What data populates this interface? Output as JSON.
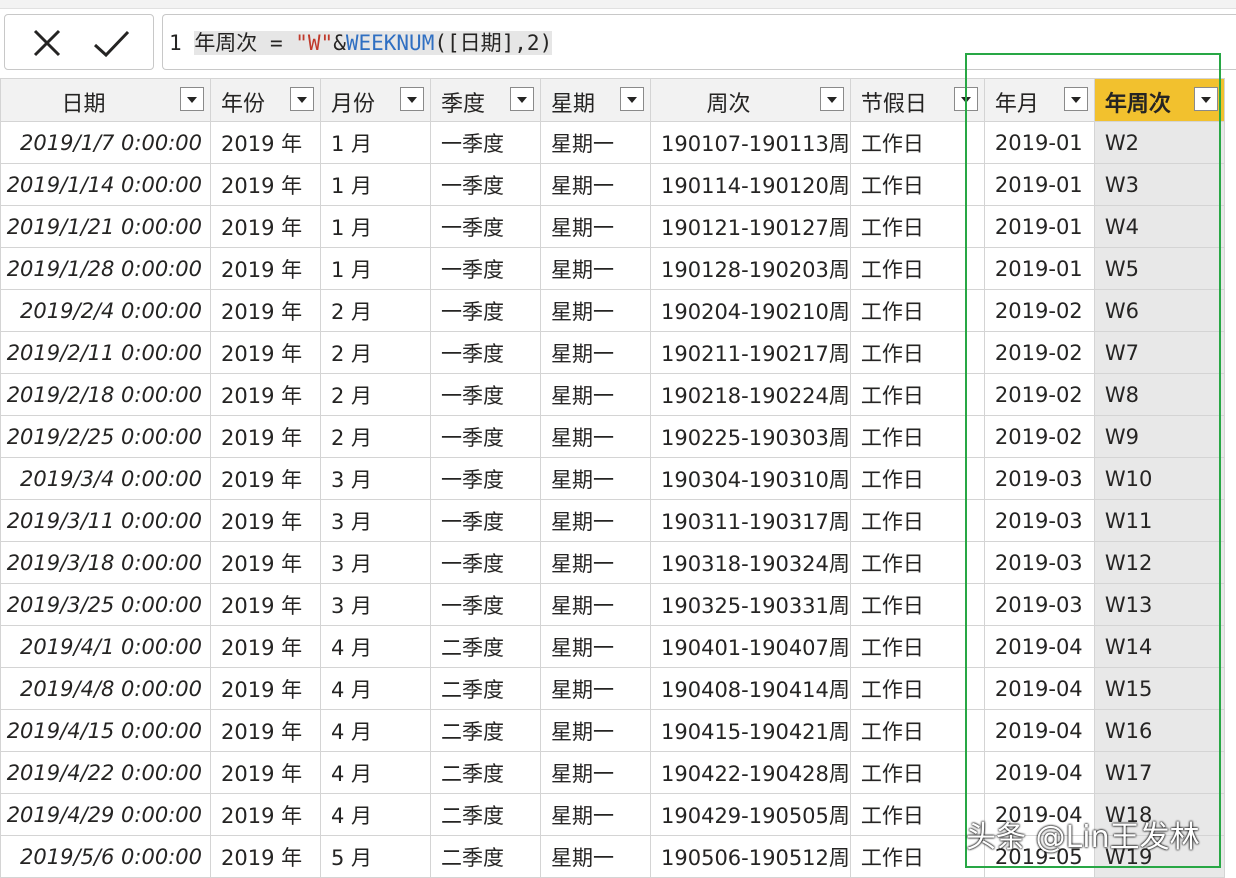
{
  "formula": {
    "line_number": "1",
    "column_name": "年周次",
    "equals": " = ",
    "string_literal": "\"W\"",
    "ampersand": "&",
    "function_name": "WEEKNUM",
    "arguments": "([日期],2)"
  },
  "columns": [
    "日期",
    "年份",
    "月份",
    "季度",
    "星期",
    "周次",
    "节假日",
    "年月",
    "年周次"
  ],
  "rows": [
    [
      "2019/1/7 0:00:00",
      "2019 年",
      "1 月",
      "一季度",
      "星期一",
      "190107-190113周",
      "工作日",
      "2019-01",
      "W2"
    ],
    [
      "2019/1/14 0:00:00",
      "2019 年",
      "1 月",
      "一季度",
      "星期一",
      "190114-190120周",
      "工作日",
      "2019-01",
      "W3"
    ],
    [
      "2019/1/21 0:00:00",
      "2019 年",
      "1 月",
      "一季度",
      "星期一",
      "190121-190127周",
      "工作日",
      "2019-01",
      "W4"
    ],
    [
      "2019/1/28 0:00:00",
      "2019 年",
      "1 月",
      "一季度",
      "星期一",
      "190128-190203周",
      "工作日",
      "2019-01",
      "W5"
    ],
    [
      "2019/2/4 0:00:00",
      "2019 年",
      "2 月",
      "一季度",
      "星期一",
      "190204-190210周",
      "工作日",
      "2019-02",
      "W6"
    ],
    [
      "2019/2/11 0:00:00",
      "2019 年",
      "2 月",
      "一季度",
      "星期一",
      "190211-190217周",
      "工作日",
      "2019-02",
      "W7"
    ],
    [
      "2019/2/18 0:00:00",
      "2019 年",
      "2 月",
      "一季度",
      "星期一",
      "190218-190224周",
      "工作日",
      "2019-02",
      "W8"
    ],
    [
      "2019/2/25 0:00:00",
      "2019 年",
      "2 月",
      "一季度",
      "星期一",
      "190225-190303周",
      "工作日",
      "2019-02",
      "W9"
    ],
    [
      "2019/3/4 0:00:00",
      "2019 年",
      "3 月",
      "一季度",
      "星期一",
      "190304-190310周",
      "工作日",
      "2019-03",
      "W10"
    ],
    [
      "2019/3/11 0:00:00",
      "2019 年",
      "3 月",
      "一季度",
      "星期一",
      "190311-190317周",
      "工作日",
      "2019-03",
      "W11"
    ],
    [
      "2019/3/18 0:00:00",
      "2019 年",
      "3 月",
      "一季度",
      "星期一",
      "190318-190324周",
      "工作日",
      "2019-03",
      "W12"
    ],
    [
      "2019/3/25 0:00:00",
      "2019 年",
      "3 月",
      "一季度",
      "星期一",
      "190325-190331周",
      "工作日",
      "2019-03",
      "W13"
    ],
    [
      "2019/4/1 0:00:00",
      "2019 年",
      "4 月",
      "二季度",
      "星期一",
      "190401-190407周",
      "工作日",
      "2019-04",
      "W14"
    ],
    [
      "2019/4/8 0:00:00",
      "2019 年",
      "4 月",
      "二季度",
      "星期一",
      "190408-190414周",
      "工作日",
      "2019-04",
      "W15"
    ],
    [
      "2019/4/15 0:00:00",
      "2019 年",
      "4 月",
      "二季度",
      "星期一",
      "190415-190421周",
      "工作日",
      "2019-04",
      "W16"
    ],
    [
      "2019/4/22 0:00:00",
      "2019 年",
      "4 月",
      "二季度",
      "星期一",
      "190422-190428周",
      "工作日",
      "2019-04",
      "W17"
    ],
    [
      "2019/4/29 0:00:00",
      "2019 年",
      "4 月",
      "二季度",
      "星期一",
      "190429-190505周",
      "工作日",
      "2019-04",
      "W18"
    ],
    [
      "2019/5/6 0:00:00",
      "2019 年",
      "5 月",
      "二季度",
      "星期一",
      "190506-190512周",
      "工作日",
      "2019-05",
      "W19"
    ]
  ],
  "watermark": "头条 @Lin王发林",
  "colors": {
    "selected_header": "#f2c12e",
    "highlight_box": "#28a745",
    "string": "#c0392b",
    "function": "#2f6fc2"
  },
  "icons": {
    "cancel": "close-icon",
    "commit": "checkmark-icon",
    "filter": "dropdown-arrow-icon"
  }
}
